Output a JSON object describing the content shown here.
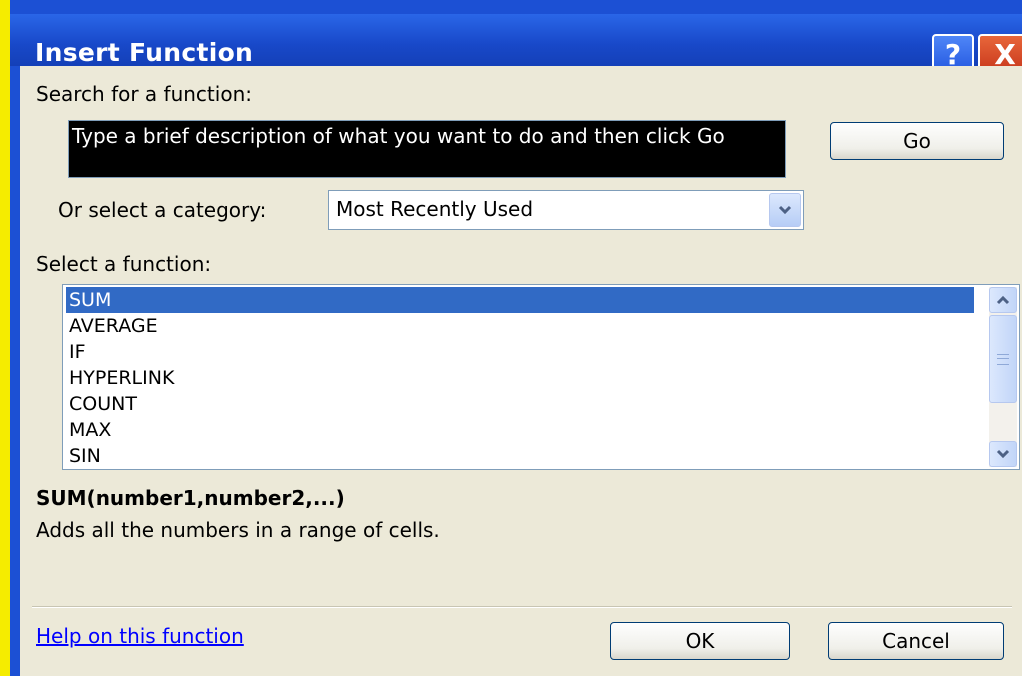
{
  "dialog": {
    "title": "Insert Function",
    "help_button": "?",
    "close_button": "X"
  },
  "search": {
    "label": "Search for a function:",
    "value": "Type a brief description of what you want to do and then click Go",
    "go_label": "Go"
  },
  "category": {
    "label": "Or select a category:",
    "selected": "Most Recently Used"
  },
  "functions": {
    "label": "Select a function:",
    "items": [
      "SUM",
      "AVERAGE",
      "IF",
      "HYPERLINK",
      "COUNT",
      "MAX",
      "SIN"
    ],
    "selected_index": 0
  },
  "details": {
    "signature": "SUM(number1,number2,...)",
    "description": "Adds all the numbers in a range of cells."
  },
  "footer": {
    "help_link": "Help on this function",
    "ok_label": "OK",
    "cancel_label": "Cancel"
  },
  "colors": {
    "title_bar": "#1848c8",
    "dialog_bg": "#ece9d8",
    "selection": "#316ac5",
    "outer_background": "#f5ec00"
  },
  "icons": [
    "help-icon",
    "close-icon",
    "chevron-down-icon",
    "scroll-up-icon",
    "scroll-down-icon"
  ]
}
